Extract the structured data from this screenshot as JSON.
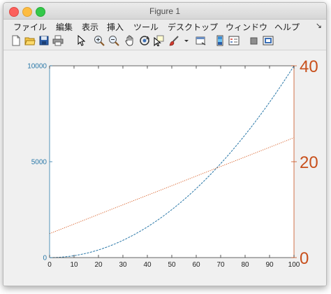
{
  "window": {
    "title": "Figure 1"
  },
  "menu": {
    "items": [
      "ファイル",
      "編集",
      "表示",
      "挿入",
      "ツール",
      "デスクトップ",
      "ウィンドウ",
      "ヘルプ"
    ],
    "overflow_icon": "chevron-right-icon"
  },
  "toolbar": {
    "buttons": [
      "new-figure-icon",
      "open-file-icon",
      "save-icon",
      "print-icon",
      "pointer-icon",
      "zoom-in-icon",
      "zoom-out-icon",
      "pan-hand-icon",
      "rotate-3d-icon",
      "data-cursor-icon",
      "brush-icon",
      "brush-dropdown-icon",
      "link-plot-icon",
      "colorbar-icon",
      "legend-icon",
      "hide-plot-tools-icon",
      "show-plot-tools-icon"
    ]
  },
  "chart_data": {
    "type": "line",
    "title": "",
    "xlabel": "",
    "ylabel_left": "",
    "ylabel_right": "",
    "xlim": [
      0,
      100
    ],
    "xticks": [
      0,
      10,
      20,
      30,
      40,
      50,
      60,
      70,
      80,
      90,
      100
    ],
    "left_axis": {
      "ylim": [
        0,
        10000
      ],
      "ticks": [
        0,
        5000,
        10000
      ],
      "color": "#2a78a8"
    },
    "right_axis": {
      "ylim": [
        0,
        400
      ],
      "ticks": [
        0,
        200,
        400
      ],
      "tick_labels": [
        "0",
        "20",
        "40"
      ],
      "color": "#c8501c"
    },
    "series": [
      {
        "axis": "left",
        "color": "#2a78a8",
        "style": "dashed",
        "formula": "y = x^2",
        "x": [
          0,
          10,
          20,
          30,
          40,
          50,
          60,
          70,
          80,
          90,
          100
        ],
        "y": [
          0,
          100,
          400,
          900,
          1600,
          2500,
          3600,
          4900,
          6400,
          8100,
          10000
        ]
      },
      {
        "axis": "right",
        "color": "#d9622b",
        "style": "dotted",
        "formula": "y = 2x + 50",
        "x": [
          0,
          100
        ],
        "y": [
          50,
          250
        ]
      }
    ],
    "grid": false,
    "legend": "none"
  }
}
